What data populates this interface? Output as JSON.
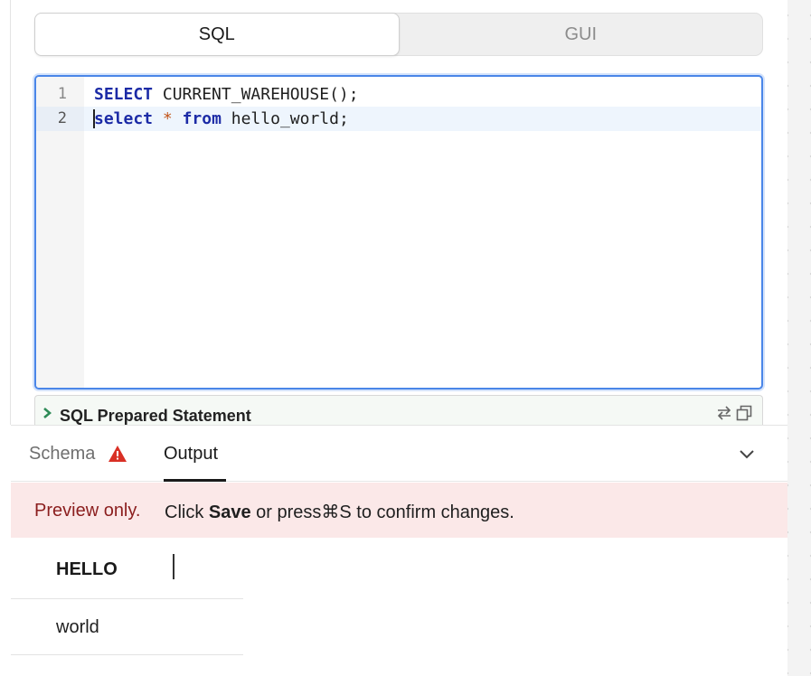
{
  "mode_toggle": {
    "tabs": [
      "SQL",
      "GUI"
    ],
    "active": "SQL"
  },
  "editor": {
    "lines": [
      {
        "number": "1",
        "tokens": [
          {
            "text": "SELECT",
            "kind": "kw"
          },
          {
            "text": " CURRENT_WAREHOUSE();",
            "kind": "plain"
          }
        ]
      },
      {
        "number": "2",
        "tokens": [
          {
            "text": "select",
            "kind": "kw"
          },
          {
            "text": " ",
            "kind": "plain"
          },
          {
            "text": "*",
            "kind": "op"
          },
          {
            "text": " ",
            "kind": "plain"
          },
          {
            "text": "from",
            "kind": "kw"
          },
          {
            "text": " hello_world;",
            "kind": "plain"
          }
        ]
      }
    ],
    "current_line": 2
  },
  "prepared_statement": {
    "label": "SQL Prepared Statement"
  },
  "bottom_tabs": {
    "schema": "Schema",
    "output": "Output",
    "active": "Output"
  },
  "banner": {
    "prefix": "Preview only.",
    "msg_before": "Click ",
    "msg_bold": "Save",
    "msg_after": " or press⌘S to confirm changes."
  },
  "results": {
    "columns": [
      "HELLO"
    ],
    "rows": [
      [
        "world"
      ]
    ]
  },
  "colors": {
    "editor_border": "#4a86e8",
    "keyword": "#1c2ba6",
    "operator": "#c2551b",
    "banner_bg": "#fbe8e8",
    "banner_prefix": "#8b1e1e",
    "warning": "#d93025"
  },
  "icons": {
    "prepared_chevron": "chevron-right-icon",
    "prepared_swap": "swap-icon",
    "prepared_popout": "popout-icon",
    "schema_warning": "warning-triangle-icon",
    "collapse": "chevron-down-icon"
  }
}
